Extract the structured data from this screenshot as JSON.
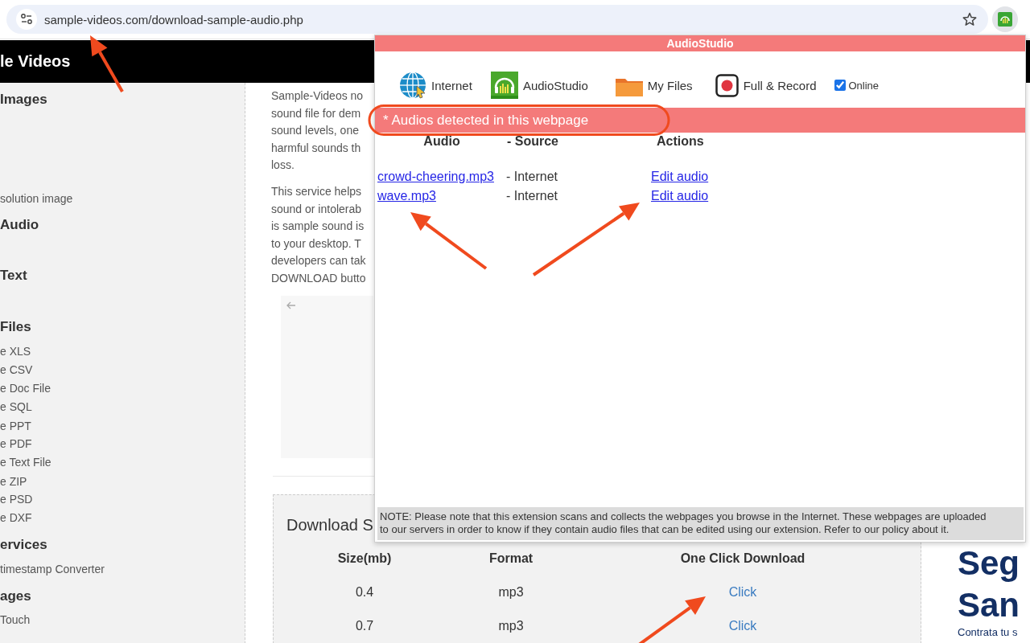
{
  "browser": {
    "url": "sample-videos.com/download-sample-audio.php"
  },
  "site": {
    "header_title": "le Videos",
    "sidebar": [
      {
        "kind": "heading",
        "text": "Images"
      },
      {
        "kind": "link",
        "text": "solution image"
      },
      {
        "kind": "heading",
        "text": "Audio"
      },
      {
        "kind": "heading",
        "text": "Text"
      },
      {
        "kind": "heading",
        "text": "Files"
      },
      {
        "kind": "link",
        "text": "e XLS"
      },
      {
        "kind": "link",
        "text": "e CSV"
      },
      {
        "kind": "link",
        "text": "e Doc File"
      },
      {
        "kind": "link",
        "text": "e SQL"
      },
      {
        "kind": "link",
        "text": "e PPT"
      },
      {
        "kind": "link",
        "text": "e PDF"
      },
      {
        "kind": "link",
        "text": "e Text File"
      },
      {
        "kind": "link",
        "text": "e ZIP"
      },
      {
        "kind": "link",
        "text": "e PSD"
      },
      {
        "kind": "link",
        "text": "e DXF"
      },
      {
        "kind": "heading",
        "text": "ervices"
      },
      {
        "kind": "link",
        "text": "timestamp Converter"
      },
      {
        "kind": "heading",
        "text": "ages"
      },
      {
        "kind": "link",
        "text": "Touch"
      }
    ],
    "paragraphs": [
      [
        "Sample-Videos no",
        "sound file for dem",
        "sound levels, one",
        "harmful sounds th",
        "loss."
      ],
      [
        "This service helps",
        "sound or intolerab",
        "is sample sound is",
        "to your desktop. T",
        "developers can tak",
        "DOWNLOAD butto"
      ]
    ],
    "download": {
      "title": "Download S",
      "columns": [
        "Size(mb)",
        "Format",
        "One Click Download"
      ],
      "rows": [
        [
          "0.4",
          "mp3",
          "Click"
        ],
        [
          "0.7",
          "mp3",
          "Click"
        ]
      ]
    },
    "promo": {
      "heading_lines": [
        "Seg",
        "San"
      ],
      "subtitle": "Contrata tu s"
    }
  },
  "popup": {
    "title": "AudioStudio",
    "toolbar": [
      {
        "kind": "button",
        "label": "Internet"
      },
      {
        "kind": "button",
        "label": "AudioStudio"
      },
      {
        "kind": "button",
        "label": "My Files"
      },
      {
        "kind": "button",
        "label": "Full & Record"
      },
      {
        "kind": "checkbox",
        "label": "Online",
        "checked": true
      }
    ],
    "banner": "* Audios detected in this webpage",
    "columns": [
      "Audio",
      "- Source",
      "Actions"
    ],
    "rows": [
      {
        "file": "crowd-cheering.mp3",
        "source": "- Internet",
        "action": "Edit audio"
      },
      {
        "file": "wave.mp3",
        "source": "- Internet",
        "action": "Edit audio"
      }
    ],
    "note": "NOTE: Please note that this extension scans and collects the webpages you browse in the Internet. These webpages are uploaded to our servers in order to know if they contain audio files that can be edited using our extension. Refer to our policy about it."
  },
  "annotations": [
    {
      "kind": "arrow"
    },
    {
      "kind": "arrow"
    },
    {
      "kind": "arrow"
    },
    {
      "kind": "arrow"
    },
    {
      "kind": "ellipse"
    }
  ]
}
